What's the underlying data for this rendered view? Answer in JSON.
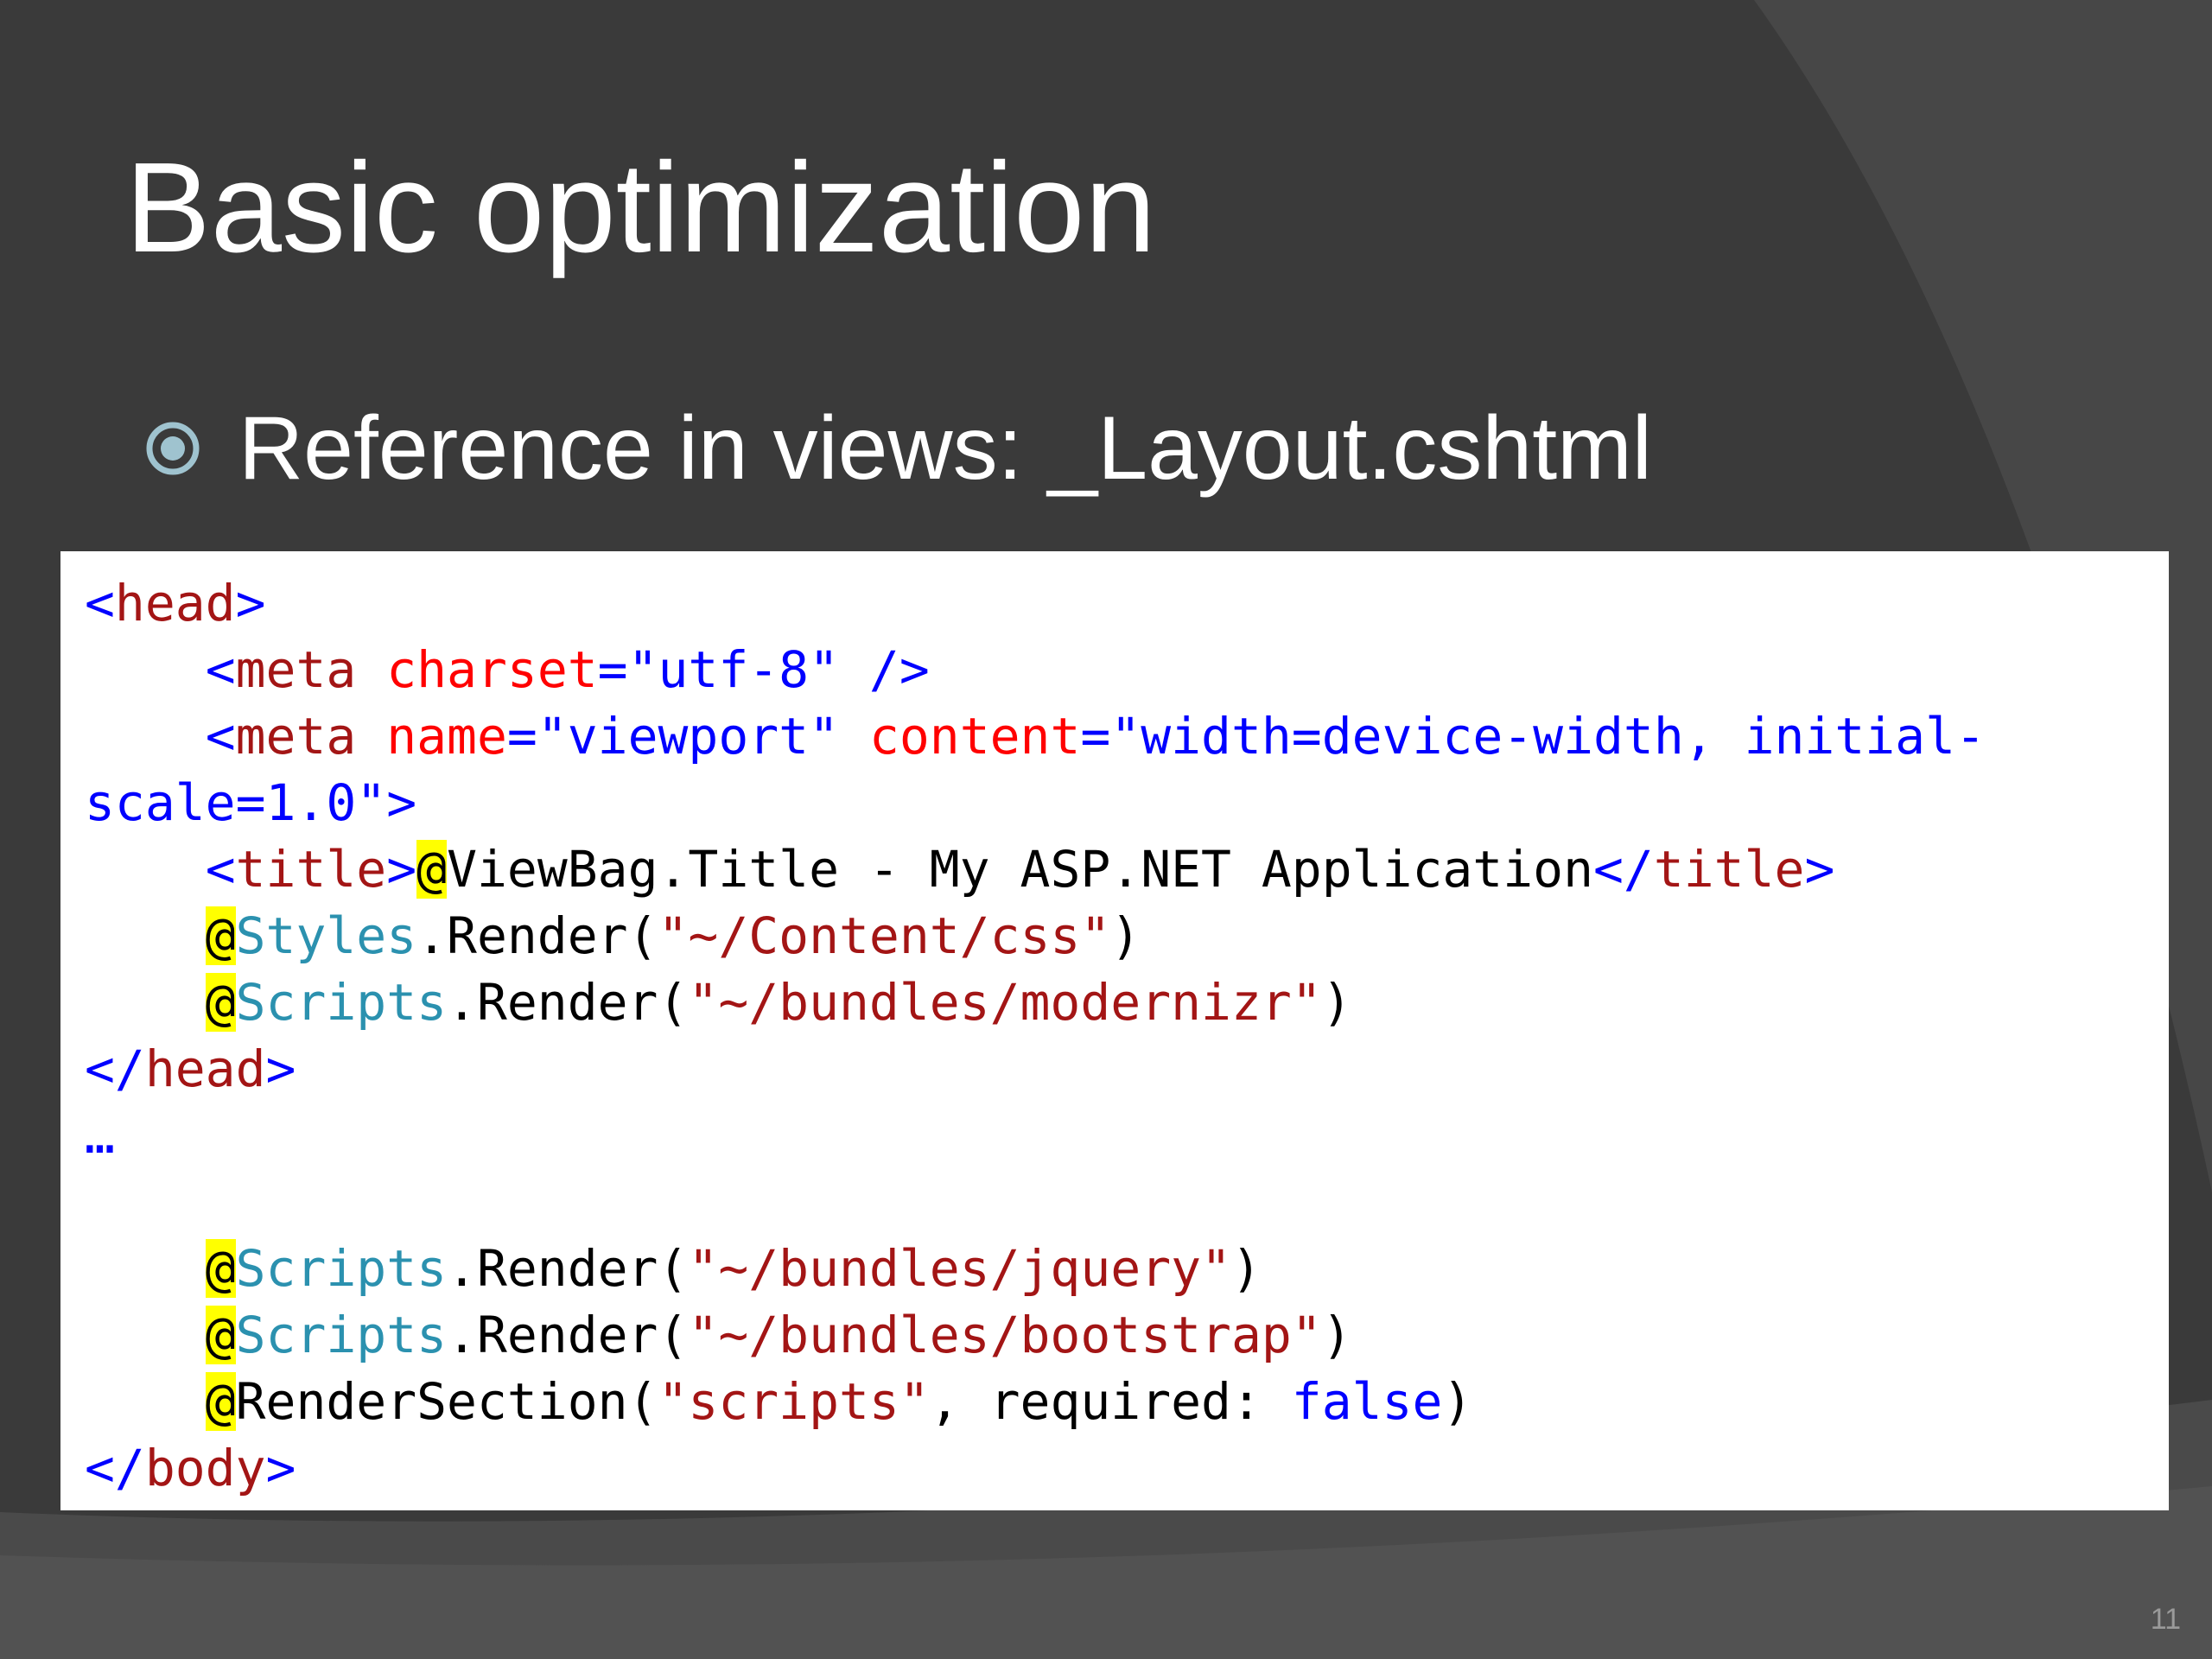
{
  "slide": {
    "title": "Basic optimization",
    "bullet": "Reference in views: _Layout.cshtml",
    "slide_number": "11",
    "bullet_icon": "circle-bullet-icon"
  },
  "colors": {
    "background": "#3b3b3b",
    "tag_blue": "#0000ff",
    "element_maroon": "#a31515",
    "attribute_red": "#ff0000",
    "class_teal": "#2b91af",
    "razor_highlight": "#ffff00"
  },
  "code": {
    "lines": [
      [
        {
          "t": "<",
          "c": "blue"
        },
        {
          "t": "head",
          "c": "maroon"
        },
        {
          "t": ">",
          "c": "blue"
        }
      ],
      [
        {
          "t": "    "
        },
        {
          "t": "<",
          "c": "blue"
        },
        {
          "t": "meta",
          "c": "maroon"
        },
        {
          "t": " "
        },
        {
          "t": "charset",
          "c": "red"
        },
        {
          "t": "=\"utf-8\" />",
          "c": "blue"
        }
      ],
      [
        {
          "t": "    "
        },
        {
          "t": "<",
          "c": "blue"
        },
        {
          "t": "meta",
          "c": "maroon"
        },
        {
          "t": " "
        },
        {
          "t": "name",
          "c": "red"
        },
        {
          "t": "=\"viewport\"",
          "c": "blue"
        },
        {
          "t": " "
        },
        {
          "t": "content",
          "c": "red"
        },
        {
          "t": "=\"width=device-width, initial-",
          "c": "blue"
        }
      ],
      [
        {
          "t": "scale=1.0\">",
          "c": "blue"
        }
      ],
      [
        {
          "t": "    "
        },
        {
          "t": "<",
          "c": "blue"
        },
        {
          "t": "title",
          "c": "maroon"
        },
        {
          "t": ">",
          "c": "blue"
        },
        {
          "t": "@",
          "c": "at"
        },
        {
          "t": "ViewBag.Title - My ASP.NET Application",
          "c": "black"
        },
        {
          "t": "</",
          "c": "blue"
        },
        {
          "t": "title",
          "c": "maroon"
        },
        {
          "t": ">",
          "c": "blue"
        }
      ],
      [
        {
          "t": "    "
        },
        {
          "t": "@",
          "c": "at"
        },
        {
          "t": "Styles",
          "c": "teal"
        },
        {
          "t": ".Render(",
          "c": "black"
        },
        {
          "t": "\"~/Content/css\"",
          "c": "maroon"
        },
        {
          "t": ")",
          "c": "black"
        }
      ],
      [
        {
          "t": "    "
        },
        {
          "t": "@",
          "c": "at"
        },
        {
          "t": "Scripts",
          "c": "teal"
        },
        {
          "t": ".Render(",
          "c": "black"
        },
        {
          "t": "\"~/bundles/modernizr\"",
          "c": "maroon"
        },
        {
          "t": ")",
          "c": "black"
        }
      ],
      [
        {
          "t": "</",
          "c": "blue"
        },
        {
          "t": "head",
          "c": "maroon"
        },
        {
          "t": ">",
          "c": "blue"
        }
      ],
      [
        {
          "t": "…",
          "c": "blue"
        }
      ],
      [],
      [
        {
          "t": "    "
        },
        {
          "t": "@",
          "c": "at"
        },
        {
          "t": "Scripts",
          "c": "teal"
        },
        {
          "t": ".Render(",
          "c": "black"
        },
        {
          "t": "\"~/bundles/jquery\"",
          "c": "maroon"
        },
        {
          "t": ")",
          "c": "black"
        }
      ],
      [
        {
          "t": "    "
        },
        {
          "t": "@",
          "c": "at"
        },
        {
          "t": "Scripts",
          "c": "teal"
        },
        {
          "t": ".Render(",
          "c": "black"
        },
        {
          "t": "\"~/bundles/bootstrap\"",
          "c": "maroon"
        },
        {
          "t": ")",
          "c": "black"
        }
      ],
      [
        {
          "t": "    "
        },
        {
          "t": "@",
          "c": "at"
        },
        {
          "t": "RenderSection(",
          "c": "black"
        },
        {
          "t": "\"scripts\"",
          "c": "maroon"
        },
        {
          "t": ", required: ",
          "c": "black"
        },
        {
          "t": "false",
          "c": "blue"
        },
        {
          "t": ")",
          "c": "black"
        }
      ],
      [
        {
          "t": "</",
          "c": "blue"
        },
        {
          "t": "body",
          "c": "maroon"
        },
        {
          "t": ">",
          "c": "blue"
        }
      ]
    ]
  }
}
